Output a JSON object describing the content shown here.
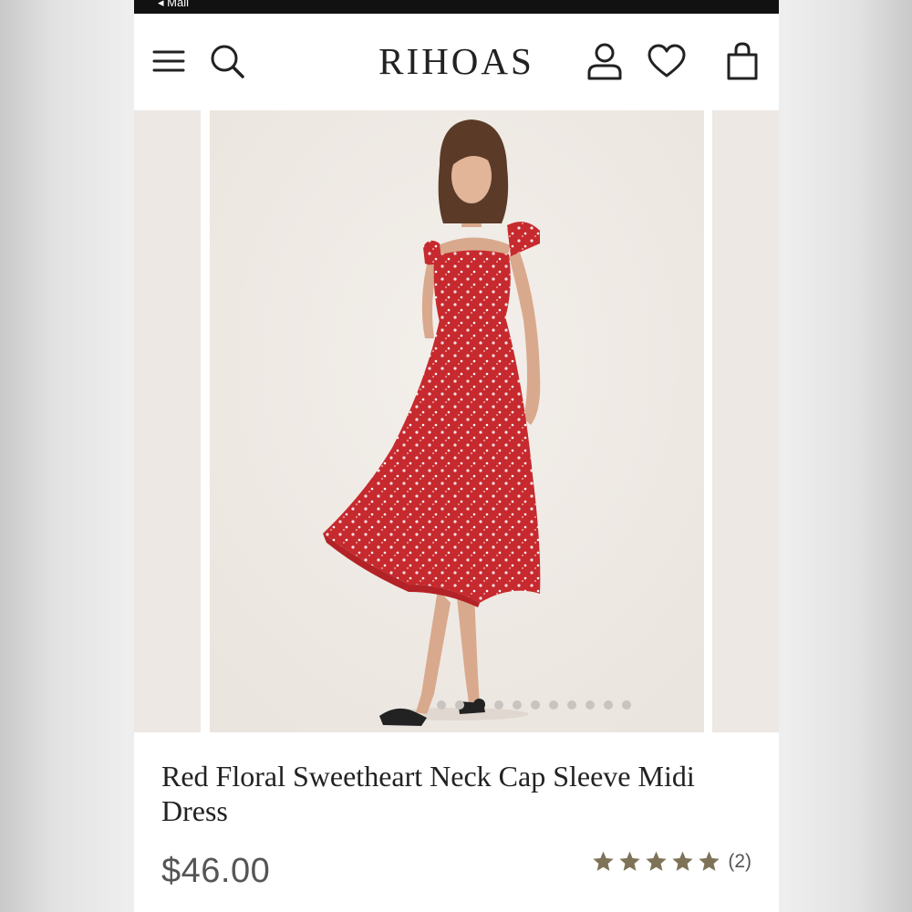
{
  "status_bar": {
    "back_label": "◂ Mail"
  },
  "header": {
    "logo": "RIHOAS",
    "icons": [
      "menu-icon",
      "search-icon",
      "account-icon",
      "wishlist-heart-icon",
      "shopping-bag-icon"
    ]
  },
  "gallery": {
    "image_count": 11,
    "active_index": 2
  },
  "product": {
    "title": "Red Floral Sweetheart Neck Cap Sleeve Midi Dress",
    "price": "$46.00",
    "rating": 5,
    "review_count": "(2)"
  },
  "colors": {
    "star": "#7e7357",
    "dress": "#c62a2e",
    "photo_bg": "#f0ebe6"
  }
}
